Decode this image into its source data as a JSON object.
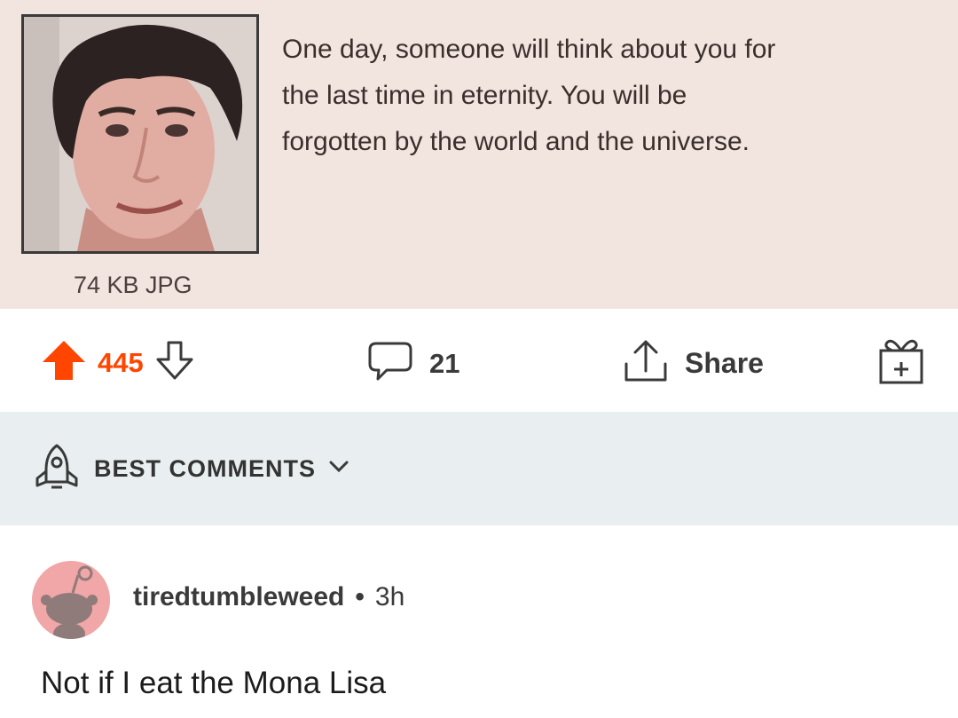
{
  "post": {
    "image": {
      "file_info": "74 KB JPG"
    },
    "text_lines": [
      "One day, someone will think about you for",
      "the last time in eternity. You will be",
      "forgotten by the world and the universe."
    ]
  },
  "actions": {
    "upvote_icon": "arrow-up-icon",
    "upvote_count": "445",
    "downvote_icon": "arrow-down-icon",
    "comment_icon": "speech-bubble-icon",
    "comment_count": "21",
    "share_icon": "share-icon",
    "share_label": "Share",
    "award_icon": "gift-icon",
    "accent_color": "#ff4500"
  },
  "comments_bar": {
    "sort_icon": "rocket-icon",
    "label": "BEST COMMENTS",
    "chevron_icon": "chevron-down-icon"
  },
  "comment": {
    "avatar_icon": "snoo-avatar-icon",
    "username": "tiredtumbleweed",
    "separator": "•",
    "age": "3h",
    "body": "Not if I eat the Mona Lisa"
  }
}
